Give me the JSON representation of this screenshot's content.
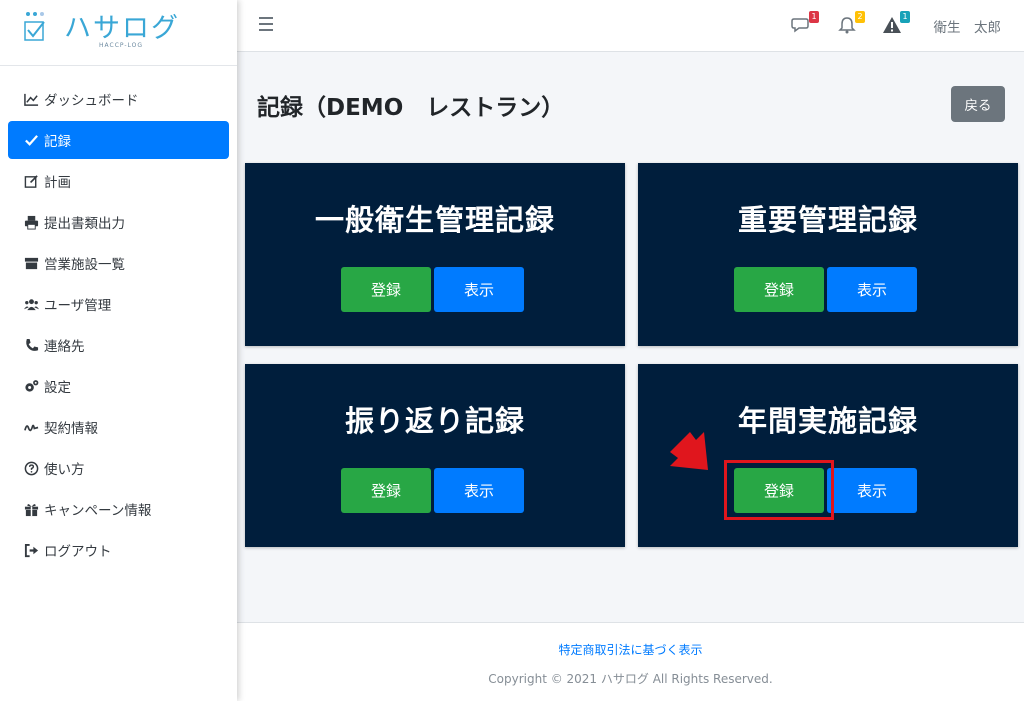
{
  "brand": {
    "name": "ハサログ",
    "sub": "HACCP-LOG"
  },
  "sidebar": {
    "items": [
      {
        "label": "ダッシュボード",
        "icon": "chart-line-icon"
      },
      {
        "label": "記録",
        "icon": "check-icon",
        "active": true
      },
      {
        "label": "計画",
        "icon": "edit-icon"
      },
      {
        "label": "提出書類出力",
        "icon": "print-icon"
      },
      {
        "label": "営業施設一覧",
        "icon": "store-icon"
      },
      {
        "label": "ユーザ管理",
        "icon": "users-icon"
      },
      {
        "label": "連絡先",
        "icon": "phone-icon"
      },
      {
        "label": "設定",
        "icon": "gears-icon"
      },
      {
        "label": "契約情報",
        "icon": "signature-icon"
      },
      {
        "label": "使い方",
        "icon": "question-circle-icon"
      },
      {
        "label": "キャンペーン情報",
        "icon": "gift-icon"
      },
      {
        "label": "ログアウト",
        "icon": "sign-out-icon"
      }
    ]
  },
  "topbar": {
    "messages_badge": "1",
    "notifications_badge": "2",
    "alerts_badge": "1",
    "user_name": "衛生　太郎"
  },
  "main": {
    "title": "記録（DEMO　レストラン）",
    "back_label": "戻る",
    "cards": [
      {
        "title": "一般衛生管理記録",
        "register_label": "登録",
        "view_label": "表示"
      },
      {
        "title": "重要管理記録",
        "register_label": "登録",
        "view_label": "表示"
      },
      {
        "title": "振り返り記録",
        "register_label": "登録",
        "view_label": "表示"
      },
      {
        "title": "年間実施記録",
        "register_label": "登録",
        "view_label": "表示"
      }
    ]
  },
  "footer": {
    "link": "特定商取引法に基づく表示",
    "copyright": "Copyright © 2021 ハサログ All Rights Reserved."
  },
  "colors": {
    "primary": "#007bff",
    "success": "#28a745",
    "card_bg": "#001e3c",
    "highlight": "#e0161d",
    "badge_red": "#dc3545",
    "badge_yellow": "#ffc107",
    "badge_teal": "#17a2b8"
  }
}
